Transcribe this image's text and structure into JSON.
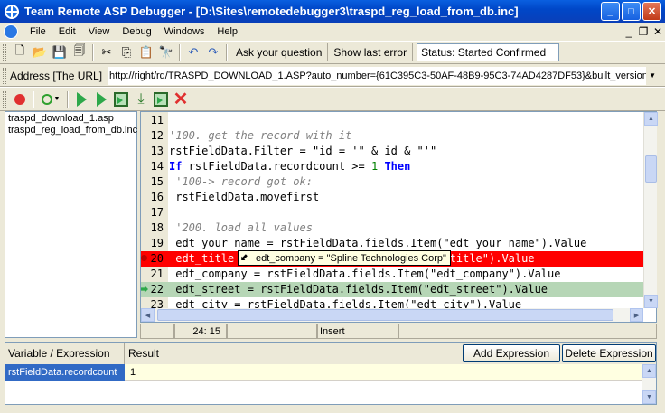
{
  "window": {
    "title": "Team Remote ASP Debugger - [D:\\Sites\\remotedebugger3\\traspd_reg_load_from_db.inc]",
    "min_label": "_",
    "max_label": "□",
    "close_label": "✕"
  },
  "menu": {
    "items": [
      "File",
      "Edit",
      "View",
      "Debug",
      "Windows",
      "Help"
    ],
    "mdi_min": "_",
    "mdi_restore": "❐",
    "mdi_close": "✕"
  },
  "toolbar": {
    "ask_label": "Ask your question",
    "show_error_label": "Show last error",
    "status_text": "Status: Started Confirmed"
  },
  "address": {
    "label": "Address [The URL]",
    "value": "http://right/rd/TRASPD_DOWNLOAD_1.ASP?auto_number={61C395C3-50AF-48B9-95C3-74AD4287DF53}&built_version="
  },
  "files": [
    "traspd_download_1.asp",
    "traspd_reg_load_from_db.inc"
  ],
  "editor": {
    "lines": [
      {
        "num": "11",
        "code": ""
      },
      {
        "num": "12",
        "code": "'100. get the record with it",
        "kind": "comment"
      },
      {
        "num": "13",
        "code": "rstFieldData.Filter = \"id = '\" & id & \"'\"",
        "kind": "plain"
      },
      {
        "num": "14",
        "code": "If rstFieldData.recordcount >= 1 Then",
        "kind": "if"
      },
      {
        "num": "15",
        "code": " '100-> record got ok:",
        "kind": "comment"
      },
      {
        "num": "16",
        "code": " rstFieldData.movefirst",
        "kind": "plain"
      },
      {
        "num": "17",
        "code": ""
      },
      {
        "num": "18",
        "code": " '200. load all values",
        "kind": "comment"
      },
      {
        "num": "19",
        "code": " edt_your_name = rstFieldData.fields.Item(\"edt_your_name\").Value",
        "kind": "plain"
      },
      {
        "num": "20",
        "code": " edt_title = rstFieldData.fields.Item(\"edt_title\").Value",
        "kind": "error"
      },
      {
        "num": "21",
        "code": " edt_company = rstFieldData.fields.Item(\"edt_company\").Value",
        "kind": "plain"
      },
      {
        "num": "22",
        "code": " edt_street = rstFieldData.fields.Item(\"edt_street\").Value",
        "kind": "current"
      },
      {
        "num": "23",
        "code": " edt_city = rstFieldData.fields.Item(\"edt_city\").Value",
        "kind": "plain"
      }
    ]
  },
  "tooltip": {
    "text": "edt_company = \"Spline Technologies Corp\""
  },
  "statusbar": {
    "position": "24: 15",
    "modified": "",
    "mode": "Insert"
  },
  "watch": {
    "col_variable": "Variable / Expression",
    "col_result": "Result",
    "add_button": "Add Expression",
    "delete_button": "Delete Expression",
    "rows": [
      {
        "variable": "rstFieldData.recordcount",
        "result": "1"
      }
    ]
  }
}
